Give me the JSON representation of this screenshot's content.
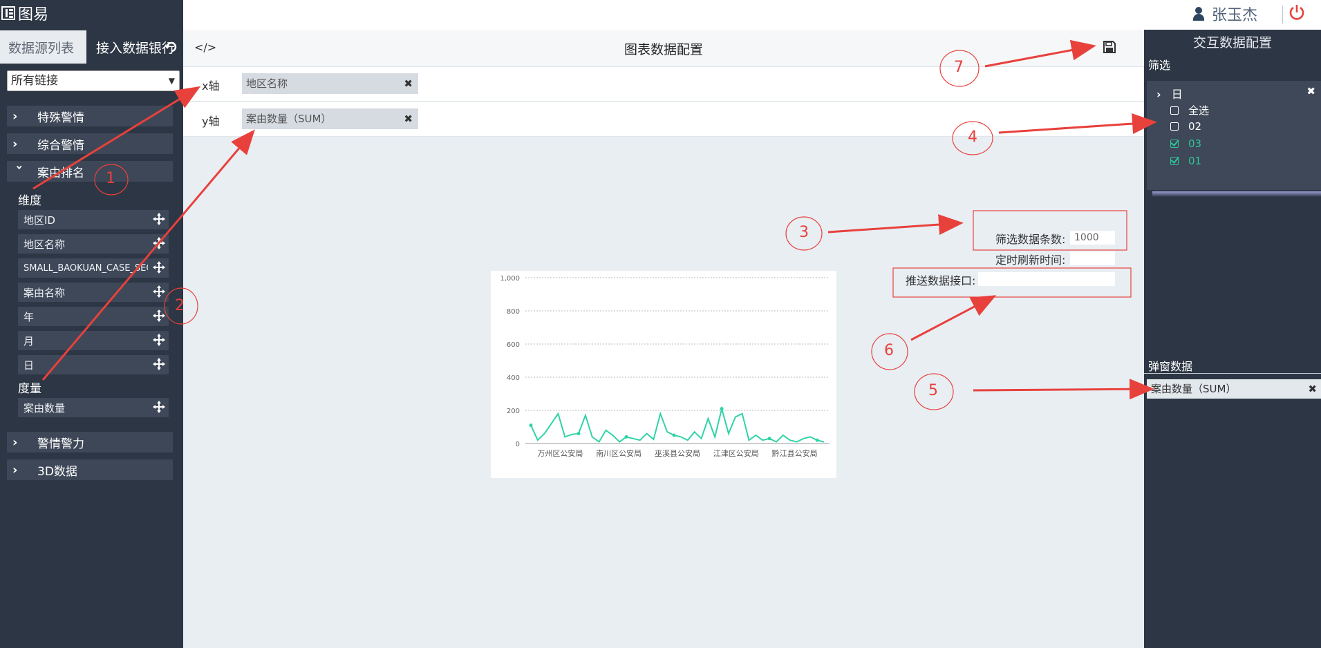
{
  "app": {
    "logo_text": "图易"
  },
  "sidebar": {
    "tabs": [
      {
        "label": "数据源列表"
      },
      {
        "label": "接入数据银行"
      }
    ],
    "source_select": "所有链接",
    "groups": [
      {
        "label": "特殊警情"
      },
      {
        "label": "综合警情"
      },
      {
        "label": "案由排名"
      },
      {
        "label": "警情警力"
      },
      {
        "label": "3D数据"
      }
    ],
    "dimension_label": "维度",
    "dimensions": [
      "地区ID",
      "地区名称",
      "SMALL_BAOKUAN_CASE_SEQ",
      "案由名称",
      "年",
      "月",
      "日"
    ],
    "measure_label": "度量",
    "measures": [
      "案由数量"
    ]
  },
  "header": {
    "user_name": "张玉杰"
  },
  "config": {
    "title": "图表数据配置",
    "x_axis_label": "x轴",
    "x_axis_field": "地区名称",
    "y_axis_label": "y轴",
    "y_axis_field": "案由数量（SUM）",
    "filter_count_label": "筛选数据条数:",
    "filter_count_value": "1000",
    "refresh_label": "定时刷新时间:",
    "refresh_value": "",
    "push_label": "推送数据接口:",
    "push_value": ""
  },
  "right_panel": {
    "title": "交互数据配置",
    "filter_title": "筛选",
    "filter_field": "日",
    "filter_options": [
      {
        "label": "全选",
        "checked": false
      },
      {
        "label": "02",
        "checked": false
      },
      {
        "label": "03",
        "checked": true
      },
      {
        "label": "01",
        "checked": true
      }
    ],
    "popup_title": "弹窗数据",
    "popup_field": "案由数量（SUM）"
  },
  "annotations": [
    "1",
    "2",
    "3",
    "4",
    "5",
    "6",
    "7"
  ],
  "colors": {
    "accent": "#2fc59a",
    "annotation": "#e8413c",
    "sidebar": "#2d3644"
  },
  "chart_data": {
    "type": "line",
    "x_tick_labels": [
      "万州区公安局",
      "南川区公安局",
      "巫溪县公安局",
      "江津区公安局",
      "黔江县公安局"
    ],
    "y_ticks": [
      "0",
      "200",
      "400",
      "600",
      "800",
      "1,000"
    ],
    "ylim": [
      0,
      1000
    ],
    "grid": true,
    "series": [
      {
        "color": "#2fd3a6",
        "values": [
          110,
          20,
          60,
          120,
          180,
          40,
          55,
          60,
          170,
          40,
          10,
          80,
          50,
          10,
          40,
          30,
          20,
          60,
          25,
          180,
          70,
          50,
          40,
          20,
          70,
          30,
          150,
          40,
          210,
          60,
          160,
          180,
          20,
          50,
          20,
          30,
          10,
          50,
          20,
          10,
          30,
          40,
          20,
          10
        ]
      }
    ]
  }
}
